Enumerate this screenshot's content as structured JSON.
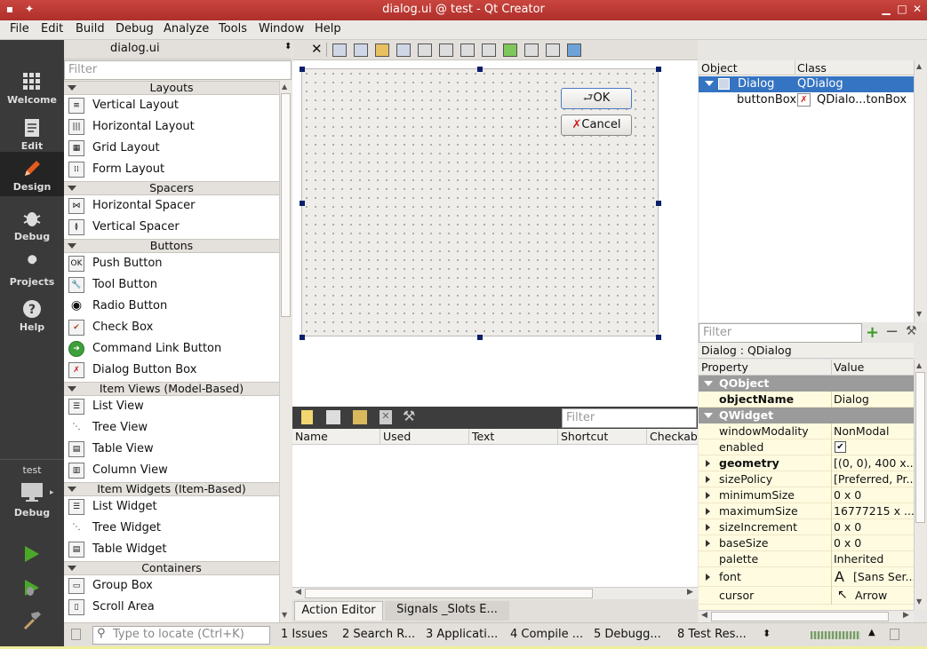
{
  "window": {
    "title": "dialog.ui @ test - Qt Creator"
  },
  "menu": [
    "File",
    "Edit",
    "Build",
    "Debug",
    "Analyze",
    "Tools",
    "Window",
    "Help"
  ],
  "modes": [
    {
      "label": "Welcome",
      "icon": "welcome-grid-icon"
    },
    {
      "label": "Edit",
      "icon": "edit-document-icon"
    },
    {
      "label": "Design",
      "icon": "design-pencil-icon",
      "active": true
    },
    {
      "label": "Debug",
      "icon": "debug-bug-icon"
    },
    {
      "label": "Projects",
      "icon": "projects-wrench-icon"
    },
    {
      "label": "Help",
      "icon": "help-question-icon"
    }
  ],
  "kit": {
    "project": "test",
    "config": "Debug"
  },
  "editor": {
    "file": "dialog.ui"
  },
  "widgetbox": {
    "filter_placeholder": "Filter",
    "categories": {
      "layouts": "Layouts",
      "spacers": "Spacers",
      "buttons": "Buttons",
      "item_views": "Item Views (Model-Based)",
      "item_widgets": "Item Widgets (Item-Based)",
      "containers": "Containers"
    },
    "items": {
      "vertical_layout": "Vertical Layout",
      "horizontal_layout": "Horizontal Layout",
      "grid_layout": "Grid Layout",
      "form_layout": "Form Layout",
      "horizontal_spacer": "Horizontal Spacer",
      "vertical_spacer": "Vertical Spacer",
      "push_button": "Push Button",
      "tool_button": "Tool Button",
      "radio_button": "Radio Button",
      "check_box": "Check Box",
      "command_link_button": "Command Link Button",
      "dialog_button_box": "Dialog Button Box",
      "list_view": "List View",
      "tree_view": "Tree View",
      "table_view": "Table View",
      "column_view": "Column View",
      "list_widget": "List Widget",
      "tree_widget": "Tree Widget",
      "table_widget": "Table Widget",
      "group_box": "Group Box",
      "scroll_area": "Scroll Area"
    },
    "push_button_glyph": "OK"
  },
  "form": {
    "ok_label": "OK",
    "cancel_label": "Cancel"
  },
  "action_editor": {
    "filter_placeholder": "Filter",
    "columns": [
      "Name",
      "Used",
      "Text",
      "Shortcut",
      "Checkable"
    ],
    "tabs": [
      "Action Editor",
      "Signals _Slots E..."
    ]
  },
  "object_inspector": {
    "columns": [
      "Object",
      "Class"
    ],
    "rows": [
      {
        "object": "Dialog",
        "class": "QDialog"
      },
      {
        "object": "buttonBox",
        "class": "QDialo...tonBox"
      }
    ]
  },
  "property_editor": {
    "filter_placeholder": "Filter",
    "context": "Dialog : QDialog",
    "columns": [
      "Property",
      "Value"
    ],
    "groups": {
      "qobject": "QObject",
      "qwidget": "QWidget"
    },
    "props": {
      "objectName": {
        "name": "objectName",
        "value": "Dialog"
      },
      "windowModality": {
        "name": "windowModality",
        "value": "NonModal"
      },
      "enabled": {
        "name": "enabled",
        "value": "✔"
      },
      "geometry": {
        "name": "geometry",
        "value": "[(0, 0), 400 x..."
      },
      "sizePolicy": {
        "name": "sizePolicy",
        "value": "[Preferred, Pr..."
      },
      "minimumSize": {
        "name": "minimumSize",
        "value": "0 x 0"
      },
      "maximumSize": {
        "name": "maximumSize",
        "value": "16777215 x ..."
      },
      "sizeIncrement": {
        "name": "sizeIncrement",
        "value": "0 x 0"
      },
      "baseSize": {
        "name": "baseSize",
        "value": "0 x 0"
      },
      "palette": {
        "name": "palette",
        "value": "Inherited"
      },
      "font": {
        "name": "font",
        "value": "[Sans Ser..."
      },
      "cursor": {
        "name": "cursor",
        "value": "Arrow"
      }
    }
  },
  "statusbar": {
    "locator_placeholder": "Type to locate (Ctrl+K)",
    "panes": [
      "1  Issues",
      "2  Search R...",
      "3  Applicati...",
      "4  Compile ...",
      "5  Debugg...",
      "8  Test Res..."
    ]
  },
  "colors": {
    "title_bar": "#b9372f",
    "mode_bar": "#3a3a3a",
    "selection": "#3574c2",
    "property_group": "#9b9b9b",
    "property_bg": "#fffbe0"
  }
}
